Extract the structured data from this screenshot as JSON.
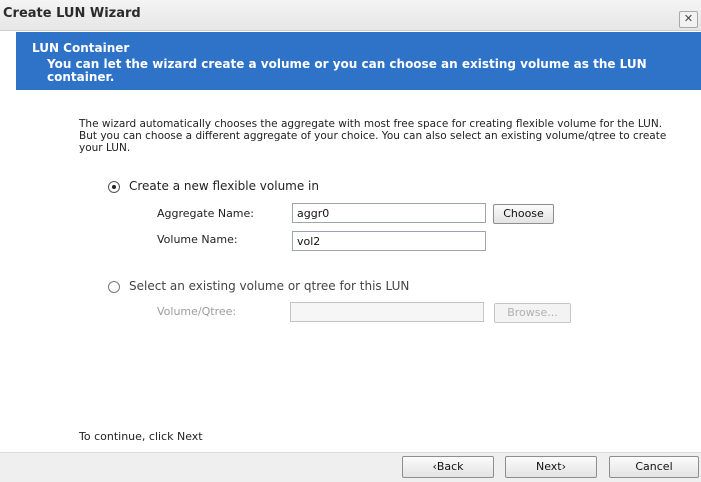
{
  "window": {
    "title": "Create LUN Wizard",
    "close_glyph": "✕"
  },
  "banner": {
    "title": "LUN Container",
    "description": "You can let the wizard create a volume or you can choose an existing volume as the LUN container."
  },
  "intro": "The wizard automatically chooses the aggregate with most free space for creating flexible volume for the LUN. But you can choose a different aggregate of your choice. You can also select an existing volume/qtree to create your LUN.",
  "option_new": {
    "label": "Create a new flexible volume in",
    "selected": true,
    "aggregate_label": "Aggregate Name:",
    "aggregate_value": "aggr0",
    "choose_label": "Choose",
    "volume_label": "Volume Name:",
    "volume_value": "vol2"
  },
  "option_existing": {
    "label": "Select an existing volume or qtree for this LUN",
    "selected": false,
    "volume_qtree_label": "Volume/Qtree:",
    "volume_qtree_value": "",
    "browse_label": "Browse..."
  },
  "hint": "To continue, click Next",
  "buttons": {
    "back": "‹Back",
    "next": "Next›",
    "cancel": "Cancel"
  }
}
